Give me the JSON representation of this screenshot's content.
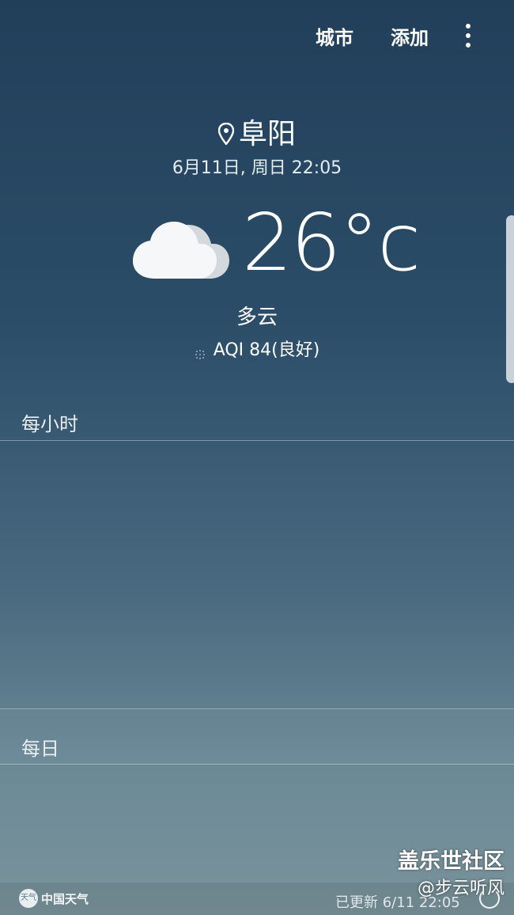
{
  "header": {
    "city_button": "城市",
    "add_button": "添加"
  },
  "location": {
    "city": "阜阳",
    "datetime": "6月11日, 周日 22:05"
  },
  "weather": {
    "temperature": "26°c",
    "condition": "多云",
    "icon": "cloudy-icon",
    "aqi": "AQI 84(良好)"
  },
  "sections": {
    "hourly_label": "每小时",
    "daily_label": "每日"
  },
  "footer": {
    "provider": "中国天气",
    "provider_mark": "天气",
    "updated": "已更新 6/11 22:05"
  },
  "watermark": {
    "line1": "盖乐世社区",
    "line2": "@步云听风"
  },
  "colors": {
    "bg_top": "#223f5a",
    "bg_bottom": "#7a939c",
    "text": "#ffffff"
  }
}
